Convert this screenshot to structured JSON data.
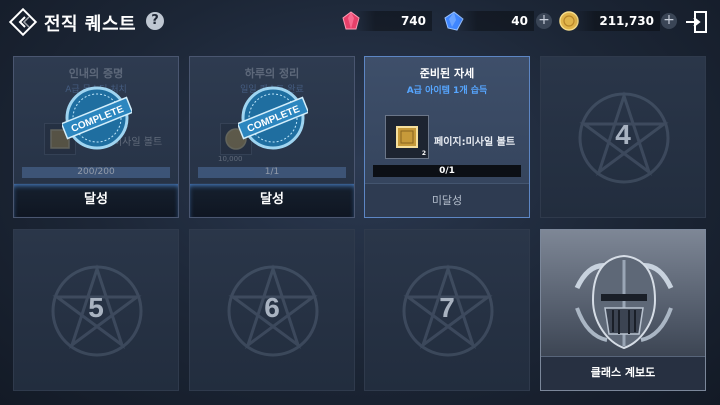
{
  "header": {
    "title": "전직 퀘스트",
    "help_label": "?"
  },
  "currencies": [
    {
      "icon": "red-gem-icon",
      "value": "740",
      "color": "#e8406a"
    },
    {
      "icon": "blue-gem-icon",
      "value": "40",
      "color": "#3f86ff"
    },
    {
      "icon": "gold-coin-icon",
      "value": "211,730",
      "color": "#e0b44a"
    }
  ],
  "plus_label": "+",
  "quests": [
    {
      "slot": 1,
      "state": "complete",
      "name": "인내의 증명",
      "desc": "A급 몬스터 처치",
      "item": "페이지:미사일 볼트",
      "progress": "200/200",
      "progress_fraction": 1.0,
      "status": "달성",
      "stamp": "COMPLETE"
    },
    {
      "slot": 2,
      "state": "complete",
      "name": "하루의 정리",
      "desc": "일일 퀘스트 완료",
      "item": "10,000",
      "progress": "1/1",
      "progress_fraction": 1.0,
      "status": "달성",
      "stamp": "COMPLETE"
    },
    {
      "slot": 3,
      "state": "active",
      "name": "준비된 자세",
      "desc": "A급 아이템 1개 습득",
      "item": "페이지:미사일 볼트",
      "item_qty": "2",
      "progress": "0/1",
      "progress_fraction": 0.0,
      "status": "미달성"
    },
    {
      "slot": 4,
      "state": "locked",
      "number": "4"
    },
    {
      "slot": 5,
      "state": "locked",
      "number": "5"
    },
    {
      "slot": 6,
      "state": "locked",
      "number": "6"
    },
    {
      "slot": 7,
      "state": "locked",
      "number": "7"
    },
    {
      "slot": 8,
      "state": "class",
      "label": "클래스 계보도"
    }
  ]
}
